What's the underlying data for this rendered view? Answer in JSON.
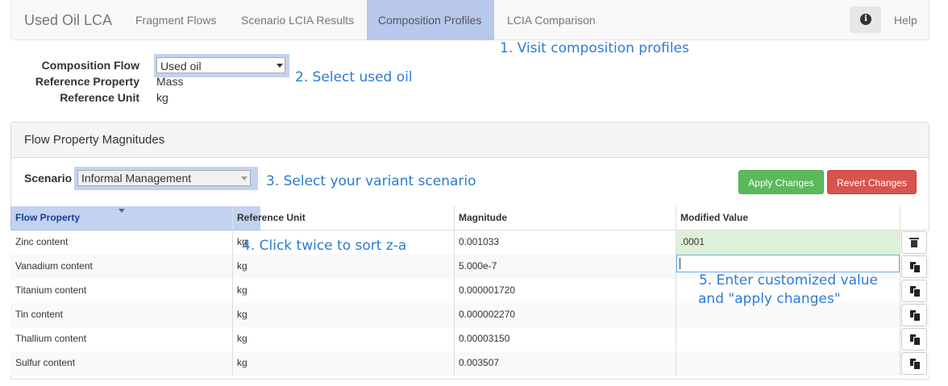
{
  "navbar": {
    "brand": "Used Oil LCA",
    "items": [
      "Fragment Flows",
      "Scenario LCIA Results",
      "Composition Profiles",
      "LCIA Comparison"
    ],
    "active_item": "Composition Profiles",
    "help_label": "Help",
    "info_icon": "info-circle-icon"
  },
  "annotations": {
    "step1": "1. Visit composition profiles",
    "step2": "2. Select used oil",
    "step3": "3. Select your variant scenario",
    "step4": "4. Click twice to sort z-a",
    "step5_line1": "5. Enter customized value",
    "step5_line2": "and \"apply changes\"",
    "highlight_color": "#789be1",
    "text_color": "#2b7bd6"
  },
  "form": {
    "composition_flow_label": "Composition Flow",
    "composition_flow_value": "Used oil",
    "reference_property_label": "Reference Property",
    "reference_property_value": "Mass",
    "reference_unit_label": "Reference Unit",
    "reference_unit_value": "kg"
  },
  "panel": {
    "title": "Flow Property Magnitudes",
    "scenario_label": "Scenario",
    "scenario_value": "Informal Management",
    "apply_label": "Apply Changes",
    "revert_label": "Revert Changes",
    "apply_color": "#5cb85c",
    "revert_color": "#d9534f"
  },
  "table": {
    "headers": [
      "Flow Property",
      "Reference Unit",
      "Magnitude",
      "Modified Value"
    ],
    "sort_indicator": "sort-desc-icon",
    "rows": [
      {
        "property": "Zinc content",
        "unit": "kg",
        "magnitude": "0.001033",
        "modified": ".0001",
        "action_icon": "trash-icon"
      },
      {
        "property": "Vanadium content",
        "unit": "kg",
        "magnitude": "5.000e-7",
        "modified": "",
        "action_icon": "copy-icon"
      },
      {
        "property": "Titanium content",
        "unit": "kg",
        "magnitude": "0.000001720",
        "modified": "",
        "action_icon": "copy-icon"
      },
      {
        "property": "Tin content",
        "unit": "kg",
        "magnitude": "0.000002270",
        "modified": "",
        "action_icon": "copy-icon"
      },
      {
        "property": "Thallium content",
        "unit": "kg",
        "magnitude": "0.00003150",
        "modified": "",
        "action_icon": "copy-icon"
      },
      {
        "property": "Sulfur content",
        "unit": "kg",
        "magnitude": "0.003507",
        "modified": "",
        "action_icon": "copy-icon"
      }
    ]
  }
}
